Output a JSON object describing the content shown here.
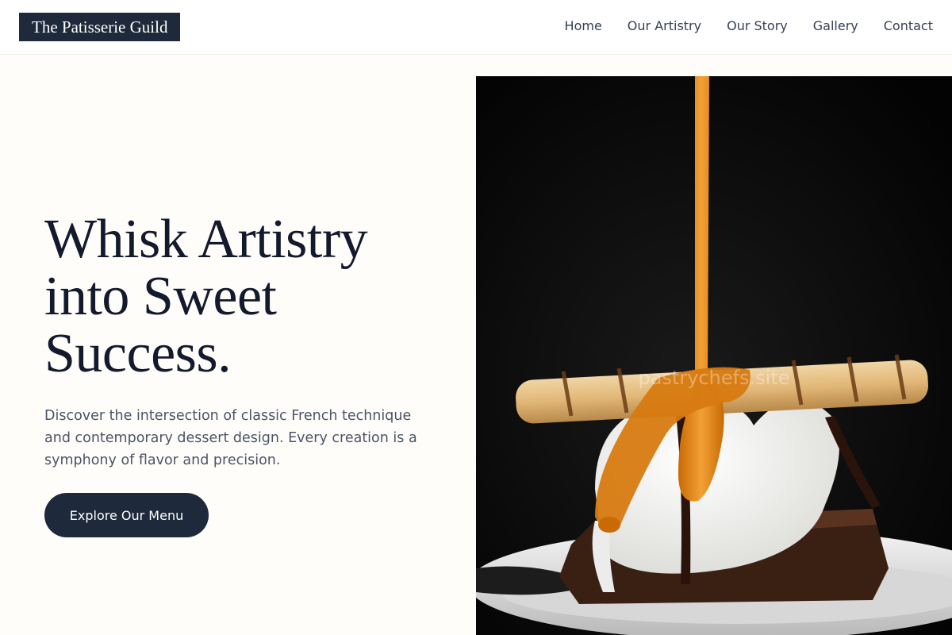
{
  "header": {
    "logo": "The Patisserie Guild",
    "nav": [
      {
        "label": "Home"
      },
      {
        "label": "Our Artistry"
      },
      {
        "label": "Our Story"
      },
      {
        "label": "Gallery"
      },
      {
        "label": "Contact"
      }
    ]
  },
  "hero": {
    "title_lines": [
      "Whisk Artistry",
      "into Sweet",
      "Success."
    ],
    "description": "Discover the intersection of classic French technique and contemporary dessert design. Every creation is a symphony of flavor and precision.",
    "cta_label": "Explore Our Menu",
    "image_watermark": "pastrychefs.site"
  },
  "colors": {
    "primary_navy": "#1e293b",
    "background_cream": "#fffdf9",
    "caramel": "#e08a10"
  }
}
